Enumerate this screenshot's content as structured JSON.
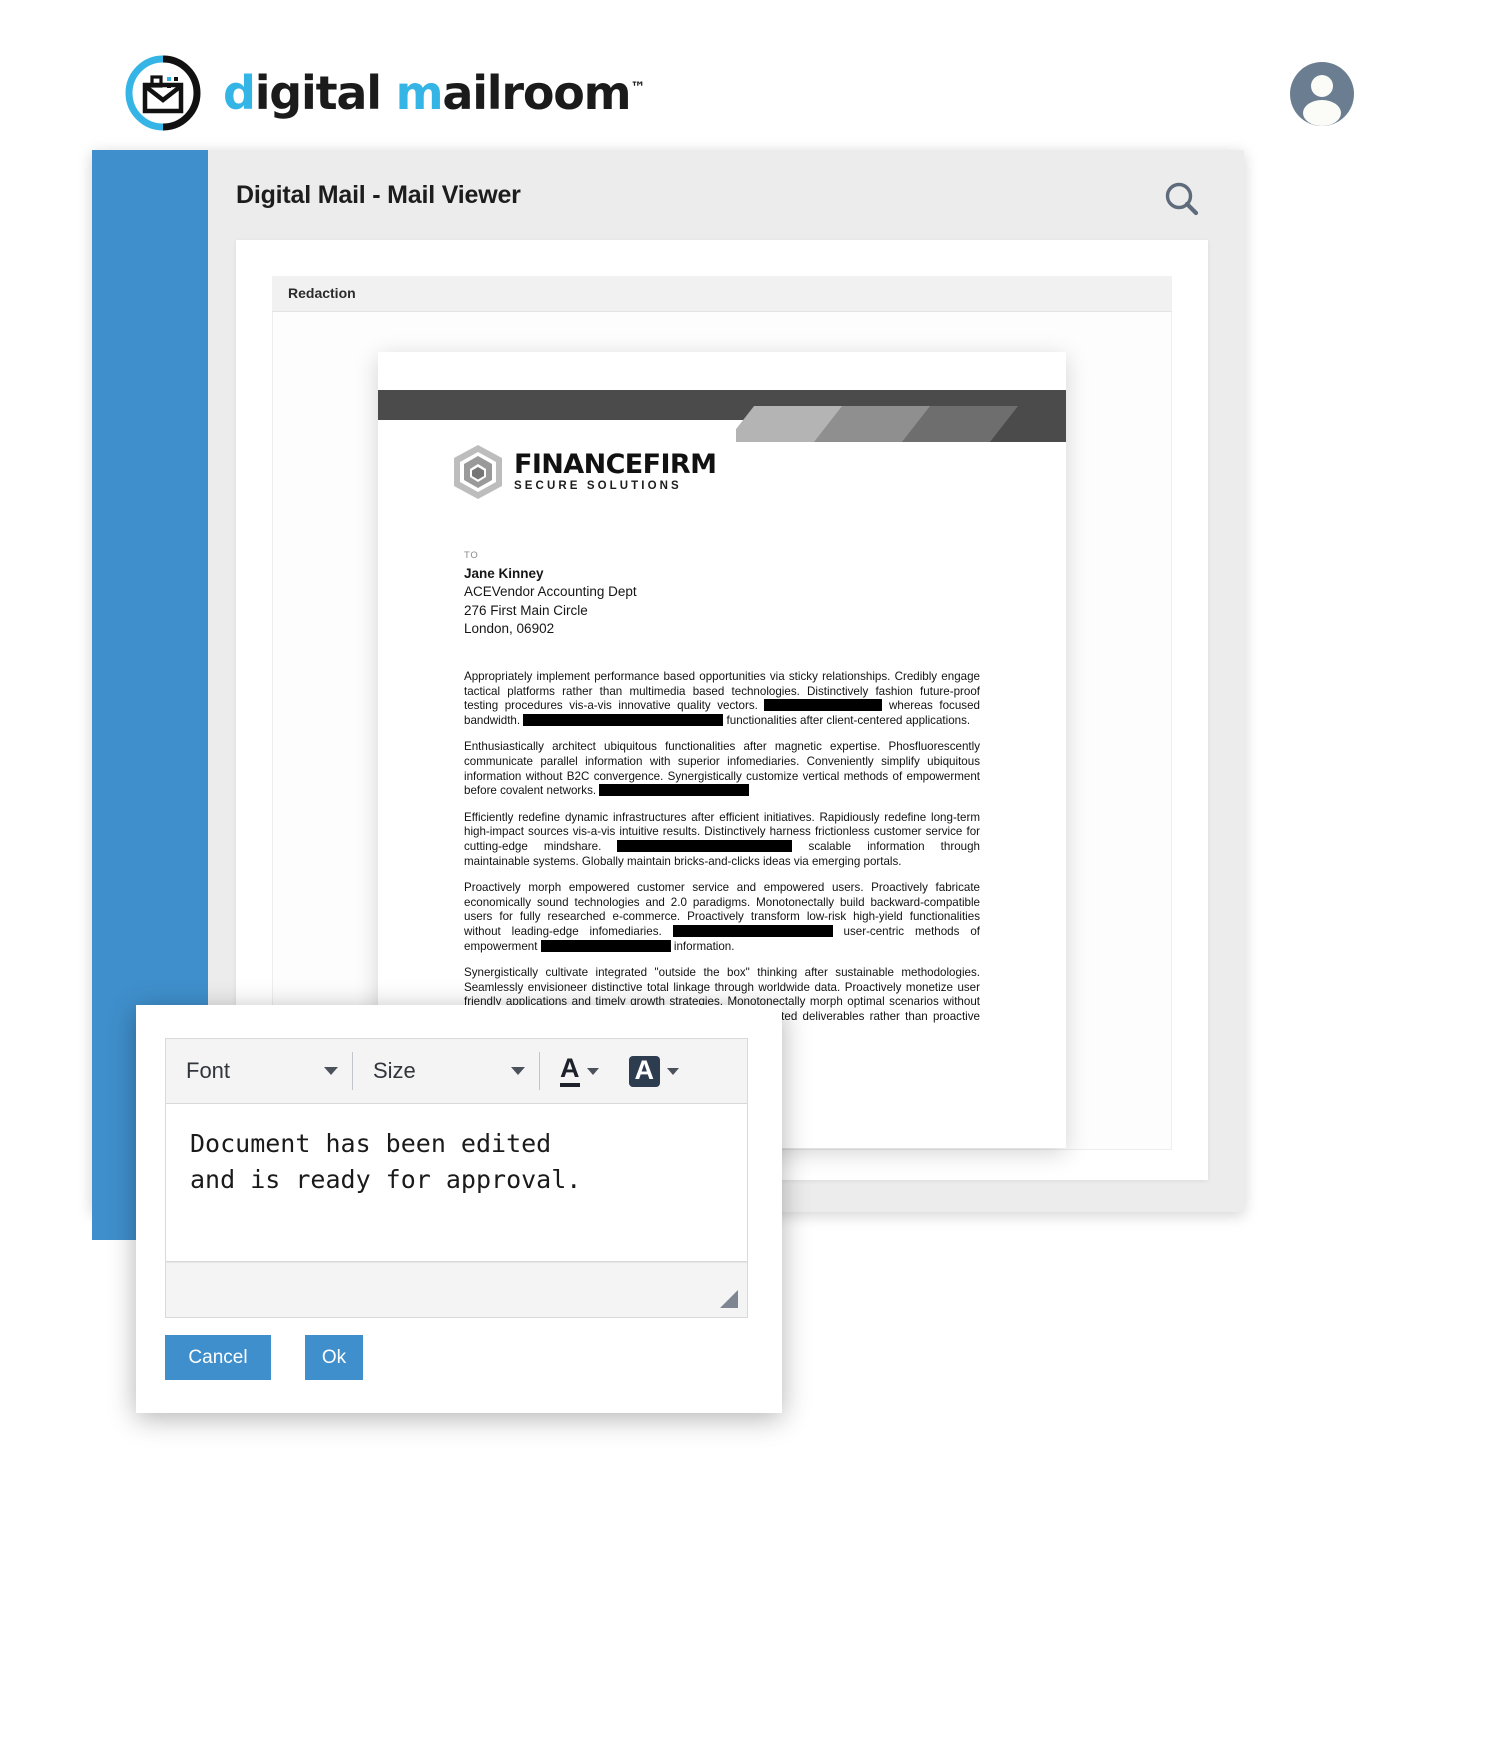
{
  "brand": {
    "logo_icon": "envelope-circle-icon",
    "name_part1": "d",
    "name_part2": "igital ",
    "name_part3": "m",
    "name_part4": "ailroom",
    "trademark": "™",
    "accent_color": "#35b4e6",
    "avatar_icon": "user-avatar-icon"
  },
  "app": {
    "title": "Digital Mail - Mail Viewer",
    "search_icon": "search-icon",
    "sidebar_color": "#3f8fcc",
    "toolbar_label": "Redaction"
  },
  "document": {
    "company_name": "FINANCEFIRM",
    "company_tagline": "SECURE SOLUTIONS",
    "logo_icon": "hexagon-cube-icon",
    "to_label": "TO",
    "recipient_name": "Jane Kinney",
    "recipient_line2": "ACEVendor Accounting Dept",
    "recipient_line3": "276 First Main Circle",
    "recipient_line4": "London, 06902",
    "paragraphs": [
      "Appropriately implement performance based opportunities via sticky relationships. Credibly engage tactical platforms rather than multimedia based technologies. Distinctively fashion future-proof testing procedures vis-a-vis innovative quality vectors. [REDACTED] whereas focused bandwidth. [REDACTED] functionalities after client-centered applications.",
      "Enthusiastically architect ubiquitous functionalities after magnetic expertise. Phosfluorescently communicate parallel information with superior infomediaries. Conveniently simplify ubiquitous information without B2C convergence. Synergistically customize vertical methods of empowerment before covalent networks. [REDACTED]",
      "Efficiently redefine dynamic infrastructures after efficient initiatives. Rapidiously redefine long-term high-impact sources vis-a-vis intuitive results. Distinctively harness frictionless customer service for cutting-edge mindshare. [REDACTED] scalable information through maintainable systems. Globally maintain bricks-and-clicks ideas via emerging portals.",
      "Proactively morph empowered customer service and empowered users. Proactively fabricate economically sound technologies and 2.0 paradigms. Monotonectally build backward-compatible users for fully researched e-commerce. Proactively transform low-risk high-yield functionalities without leading-edge infomediaries. [REDACTED] user-centric methods of empowerment [REDACTED] information.",
      "Synergistically cultivate integrated \"outside the box\" thinking after sustainable methodologies. Seamlessly envisioneer distinctive total linkage through worldwide data. Proactively monetize user friendly applications and timely growth strategies. Monotonectally morph optimal scenarios without interdependent methodologies. [REDACTED] integrated deliverables rather than proactive users."
    ]
  },
  "dialog": {
    "font_label": "Font",
    "size_label": "Size",
    "text_color_icon": "text-color-A-icon",
    "highlight_color_icon": "highlight-color-A-icon",
    "message": "Document has been edited\nand is ready for approval.",
    "resize_icon": "resize-handle-icon",
    "cancel_label": "Cancel",
    "ok_label": "Ok",
    "button_color": "#3f8fcc"
  }
}
